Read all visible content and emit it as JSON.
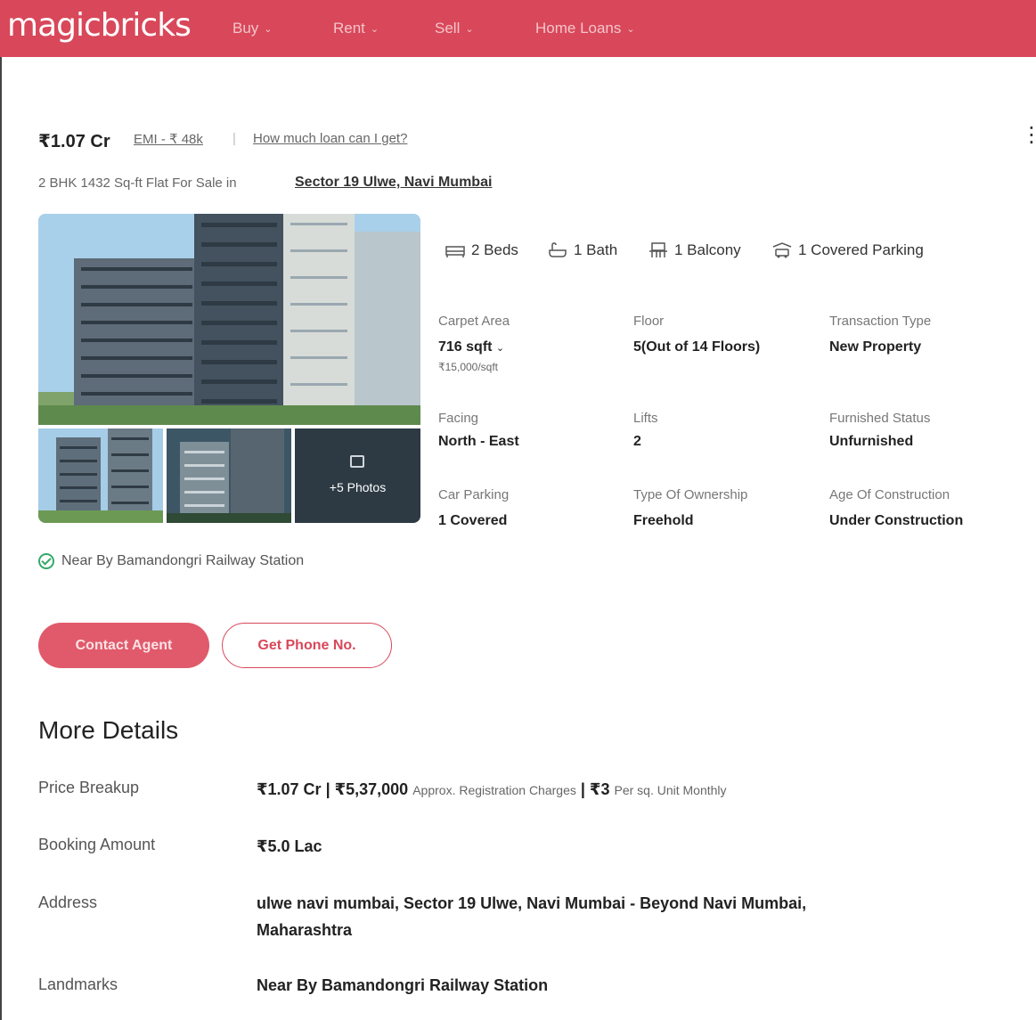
{
  "brand": {
    "logo_text": "magicbricks",
    "accent": "#d8485a"
  },
  "nav": [
    {
      "label": "Buy"
    },
    {
      "label": "Rent"
    },
    {
      "label": "Sell"
    },
    {
      "label": "Home Loans"
    }
  ],
  "listing": {
    "price": "₹1.07 Cr",
    "emi": "EMI - ₹ 48k",
    "separator": "|",
    "loan_link": "How much loan can I get?",
    "subtitle": "2 BHK 1432 Sq-ft Flat For Sale in",
    "locality": "Sector 19 Ulwe, Navi Mumbai",
    "more_photos": "+5 Photos",
    "features": {
      "beds": "2 Beds",
      "bath": "1 Bath",
      "balcony": "1 Balcony",
      "parking": "1 Covered Parking"
    },
    "specs": {
      "carpet_area_label": "Carpet Area",
      "carpet_area_value": "716 sqft",
      "carpet_area_rate": "₹15,000/sqft",
      "floor_label": "Floor",
      "floor_value": "5(Out of 14 Floors)",
      "transaction_label": "Transaction Type",
      "transaction_value": "New Property",
      "facing_label": "Facing",
      "facing_value": "North - East",
      "lifts_label": "Lifts",
      "lifts_value": "2",
      "furnished_label": "Furnished Status",
      "furnished_value": "Unfurnished",
      "car_parking_label": "Car Parking",
      "car_parking_value": "1 Covered",
      "ownership_label": "Type Of Ownership",
      "ownership_value": "Freehold",
      "age_label": "Age Of Construction",
      "age_value": "Under Construction"
    },
    "landmark_tag": "Near By Bamandongri Railway Station",
    "contact_button": "Contact Agent",
    "phone_button": "Get Phone No."
  },
  "more_details": {
    "title": "More Details",
    "price_breakup_label": "Price Breakup",
    "price_breakup_value": "₹1.07 Cr | ₹5,37,000",
    "registration_note": "Approx. Registration Charges",
    "maintenance_value": "| ₹3",
    "maintenance_note": "Per sq. Unit Monthly",
    "booking_label": "Booking Amount",
    "booking_value": "₹5.0 Lac",
    "address_label": "Address",
    "address_line1": "ulwe navi mumbai, Sector 19 Ulwe, Navi Mumbai - Beyond Navi Mumbai,",
    "address_line2": "Maharashtra",
    "landmarks_label": "Landmarks",
    "landmarks_value": "Near By Bamandongri Railway Station"
  }
}
